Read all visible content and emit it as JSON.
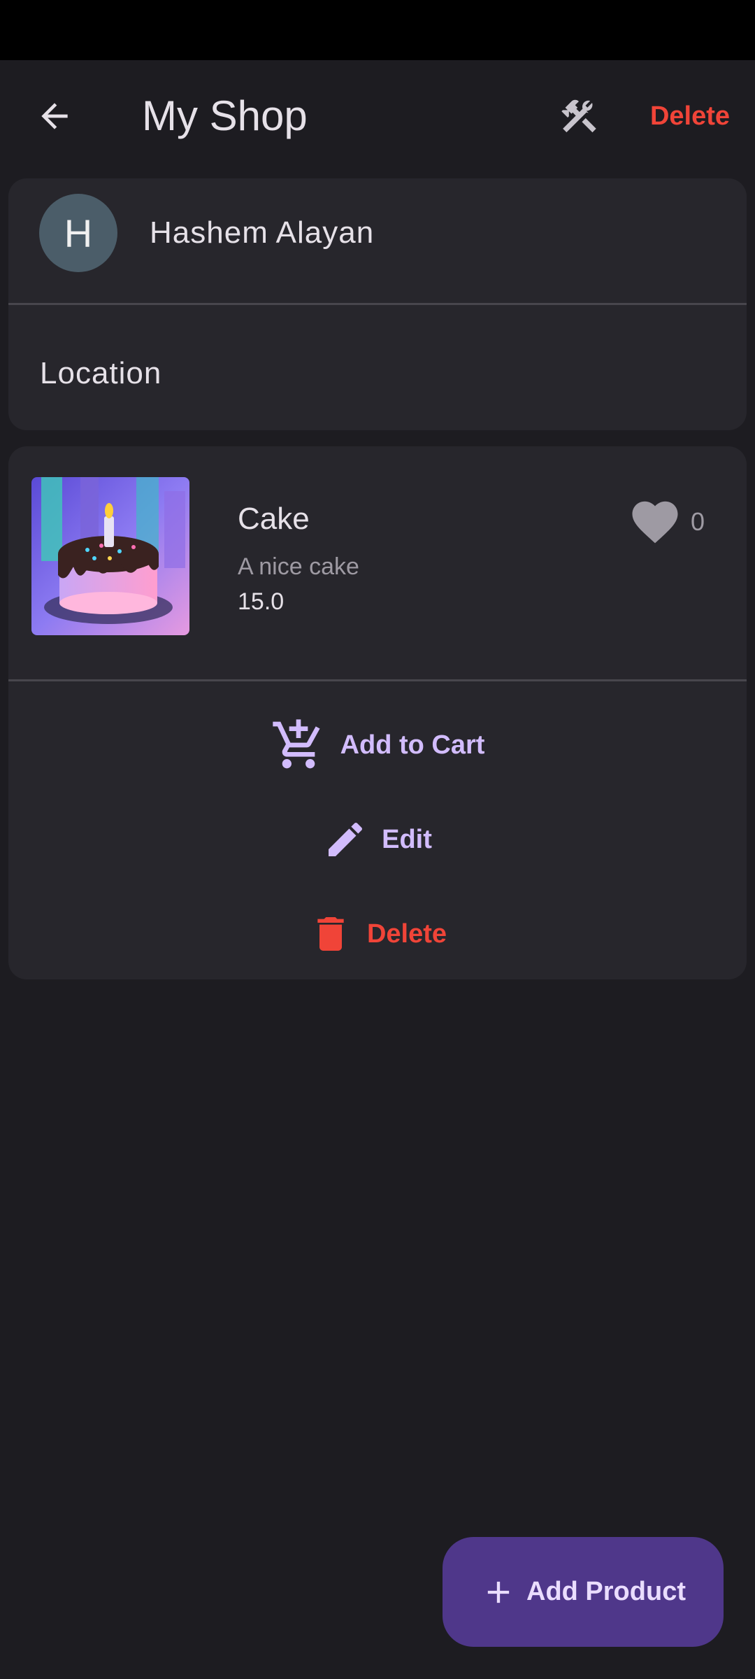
{
  "app_bar": {
    "title": "My Shop",
    "delete_label": "Delete"
  },
  "shop": {
    "avatar_initial": "H",
    "owner_name": "Hashem Alayan",
    "location_label": "Location"
  },
  "product": {
    "name": "Cake",
    "description": "A nice cake",
    "price": "15.0",
    "like_count": "0",
    "actions": {
      "add_to_cart": "Add to Cart",
      "edit": "Edit",
      "delete": "Delete"
    }
  },
  "fab": {
    "label": "Add Product"
  },
  "icons": {
    "back": "arrow-back-icon",
    "tools": "tools-icon",
    "like": "heart-icon",
    "cart": "add-shopping-cart-icon",
    "edit": "pencil-icon",
    "delete": "trash-icon",
    "add": "plus-icon"
  },
  "colors": {
    "background": "#1d1c21",
    "card": "#27262c",
    "accent": "#d2bcfd",
    "danger": "#f04438",
    "fab": "#4f378a"
  }
}
